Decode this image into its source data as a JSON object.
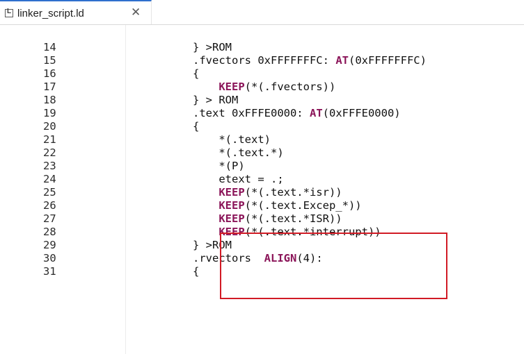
{
  "tab": {
    "icon_letter": "L",
    "label": "linker_script.ld",
    "close": "✕"
  },
  "lines": [
    {
      "number": "14",
      "parts": [
        {
          "text": "} >ROM",
          "kw": false
        }
      ]
    },
    {
      "number": "15",
      "parts": [
        {
          "text": ".fvectors 0xFFFFFFFC: ",
          "kw": false
        },
        {
          "text": "AT",
          "kw": true
        },
        {
          "text": "(0xFFFFFFFC)",
          "kw": false
        }
      ]
    },
    {
      "number": "16",
      "parts": [
        {
          "text": "{",
          "kw": false
        }
      ]
    },
    {
      "number": "17",
      "parts": [
        {
          "text": "    ",
          "kw": false
        },
        {
          "text": "KEEP",
          "kw": true
        },
        {
          "text": "(*(.fvectors))",
          "kw": false
        }
      ]
    },
    {
      "number": "18",
      "parts": [
        {
          "text": "} > ROM",
          "kw": false
        }
      ]
    },
    {
      "number": "19",
      "parts": [
        {
          "text": ".text 0xFFFE0000: ",
          "kw": false
        },
        {
          "text": "AT",
          "kw": true
        },
        {
          "text": "(0xFFFE0000)",
          "kw": false
        }
      ]
    },
    {
      "number": "20",
      "parts": [
        {
          "text": "{",
          "kw": false
        }
      ]
    },
    {
      "number": "21",
      "parts": [
        {
          "text": "    *(.text)",
          "kw": false
        }
      ]
    },
    {
      "number": "22",
      "parts": [
        {
          "text": "    *(.text.*)",
          "kw": false
        }
      ]
    },
    {
      "number": "23",
      "parts": [
        {
          "text": "    *(P)",
          "kw": false
        }
      ]
    },
    {
      "number": "24",
      "parts": [
        {
          "text": "    etext = .;",
          "kw": false
        }
      ]
    },
    {
      "number": "25",
      "parts": [
        {
          "text": "    ",
          "kw": false
        },
        {
          "text": "KEEP",
          "kw": true
        },
        {
          "text": "(*(.text.*isr))",
          "kw": false
        }
      ]
    },
    {
      "number": "26",
      "parts": [
        {
          "text": "    ",
          "kw": false
        },
        {
          "text": "KEEP",
          "kw": true
        },
        {
          "text": "(*(.text.Excep_*))",
          "kw": false
        }
      ]
    },
    {
      "number": "27",
      "parts": [
        {
          "text": "    ",
          "kw": false
        },
        {
          "text": "KEEP",
          "kw": true
        },
        {
          "text": "(*(.text.*ISR))",
          "kw": false
        }
      ]
    },
    {
      "number": "28",
      "parts": [
        {
          "text": "    ",
          "kw": false
        },
        {
          "text": "KEEP",
          "kw": true
        },
        {
          "text": "(*(.text.*interrupt))",
          "kw": false
        }
      ]
    },
    {
      "number": "29",
      "parts": [
        {
          "text": "} >ROM",
          "kw": false
        }
      ]
    },
    {
      "number": "30",
      "parts": [
        {
          "text": ".rvectors  ",
          "kw": false
        },
        {
          "text": "ALIGN",
          "kw": true
        },
        {
          "text": "(4):",
          "kw": false
        }
      ]
    },
    {
      "number": "31",
      "parts": [
        {
          "text": "{",
          "kw": false
        }
      ]
    }
  ],
  "highlight": {
    "color": "#d11a24",
    "first_line": "25",
    "last_line": "28"
  },
  "colors": {
    "keyword": "#8b1559",
    "tab_accent": "#2f6fce"
  }
}
